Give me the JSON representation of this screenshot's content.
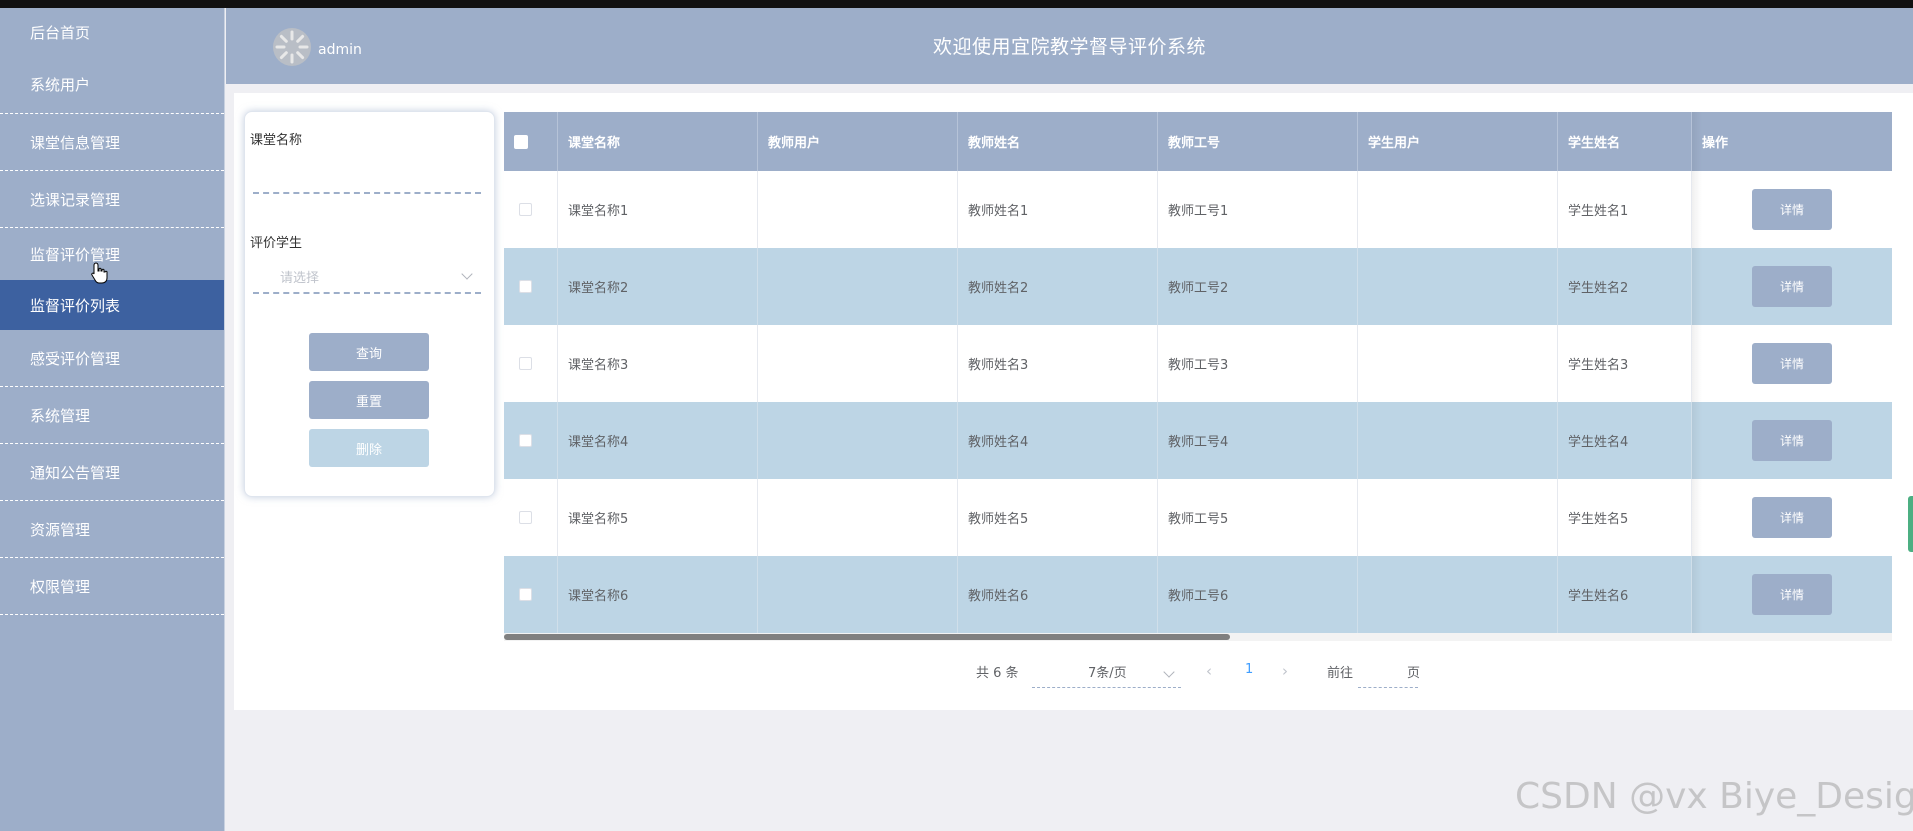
{
  "sidebar": {
    "items": [
      {
        "label": "后台首页"
      },
      {
        "label": "系统用户"
      },
      {
        "label": "课堂信息管理"
      },
      {
        "label": "选课记录管理"
      },
      {
        "label": "监督评价管理"
      },
      {
        "label": "监督评价列表"
      },
      {
        "label": "感受评价管理"
      },
      {
        "label": "系统管理"
      },
      {
        "label": "通知公告管理"
      },
      {
        "label": "资源管理"
      },
      {
        "label": "权限管理"
      }
    ],
    "active_index": 5
  },
  "header": {
    "username": "admin",
    "title": "欢迎使用宜院教学督导评价系统"
  },
  "search": {
    "course_label": "课堂名称",
    "course_value": "",
    "student_label": "评价学生",
    "student_placeholder": "请选择",
    "query_label": "查询",
    "reset_label": "重置",
    "delete_label": "删除"
  },
  "table": {
    "columns": [
      "课堂名称",
      "教师用户",
      "教师姓名",
      "教师工号",
      "学生用户",
      "学生姓名",
      "操作"
    ],
    "rows": [
      {
        "course": "课堂名称1",
        "teacher_user": "",
        "teacher_name": "教师姓名1",
        "teacher_no": "教师工号1",
        "student_user": "",
        "student_name": "学生姓名1",
        "action": "详情"
      },
      {
        "course": "课堂名称2",
        "teacher_user": "",
        "teacher_name": "教师姓名2",
        "teacher_no": "教师工号2",
        "student_user": "",
        "student_name": "学生姓名2",
        "action": "详情"
      },
      {
        "course": "课堂名称3",
        "teacher_user": "",
        "teacher_name": "教师姓名3",
        "teacher_no": "教师工号3",
        "student_user": "",
        "student_name": "学生姓名3",
        "action": "详情"
      },
      {
        "course": "课堂名称4",
        "teacher_user": "",
        "teacher_name": "教师姓名4",
        "teacher_no": "教师工号4",
        "student_user": "",
        "student_name": "学生姓名4",
        "action": "详情"
      },
      {
        "course": "课堂名称5",
        "teacher_user": "",
        "teacher_name": "教师姓名5",
        "teacher_no": "教师工号5",
        "student_user": "",
        "student_name": "学生姓名5",
        "action": "详情"
      },
      {
        "course": "课堂名称6",
        "teacher_user": "",
        "teacher_name": "教师姓名6",
        "teacher_no": "教师工号6",
        "student_user": "",
        "student_name": "学生姓名6",
        "action": "详情"
      }
    ]
  },
  "pagination": {
    "total": "共 6 条",
    "page_size": "7条/页",
    "current_page": "1",
    "goto_label": "前往",
    "page_suffix": "页"
  },
  "watermark": "CSDN @vx  Biye_Design",
  "colors": {
    "sidebar_bg": "#9daec9",
    "active_bg": "#3d61a0",
    "row_alt": "#bdd5e5",
    "accent": "#409eff"
  }
}
